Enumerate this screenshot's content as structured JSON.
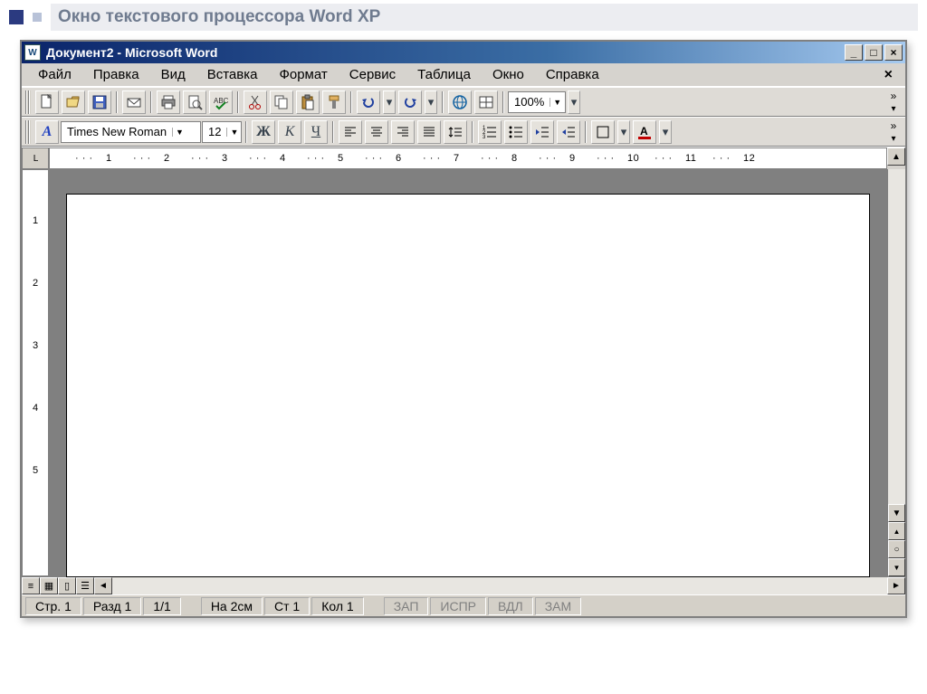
{
  "slide": {
    "title": "Окно текстового процессора Word XP"
  },
  "titlebar": {
    "text": "Документ2 - Microsoft Word"
  },
  "winbuttons": {
    "min": "_",
    "max": "□",
    "close": "×"
  },
  "menu": {
    "items": [
      "Файл",
      "Правка",
      "Вид",
      "Вставка",
      "Формат",
      "Сервис",
      "Таблица",
      "Окно",
      "Справка"
    ],
    "close_doc": "×"
  },
  "toolbar1": {
    "zoom": "100%",
    "expand": "»"
  },
  "toolbar2": {
    "font_name": "Times New Roman",
    "font_size": "12",
    "bold": "Ж",
    "italic": "К",
    "underline": "Ч",
    "expand": "»"
  },
  "ruler": {
    "corner": "L",
    "units": [
      "1",
      "2",
      "3",
      "4",
      "5",
      "6",
      "7",
      "8",
      "9",
      "10",
      "11",
      "12"
    ]
  },
  "vruler": {
    "units": [
      "1",
      "2",
      "3",
      "4",
      "5"
    ]
  },
  "statusbar": {
    "page": "Стр. 1",
    "section": "Разд 1",
    "progress": "1/1",
    "at": "На 2см",
    "line": "Ст 1",
    "col": "Кол 1",
    "flags": [
      "ЗАП",
      "ИСПР",
      "ВДЛ",
      "ЗАМ"
    ]
  }
}
